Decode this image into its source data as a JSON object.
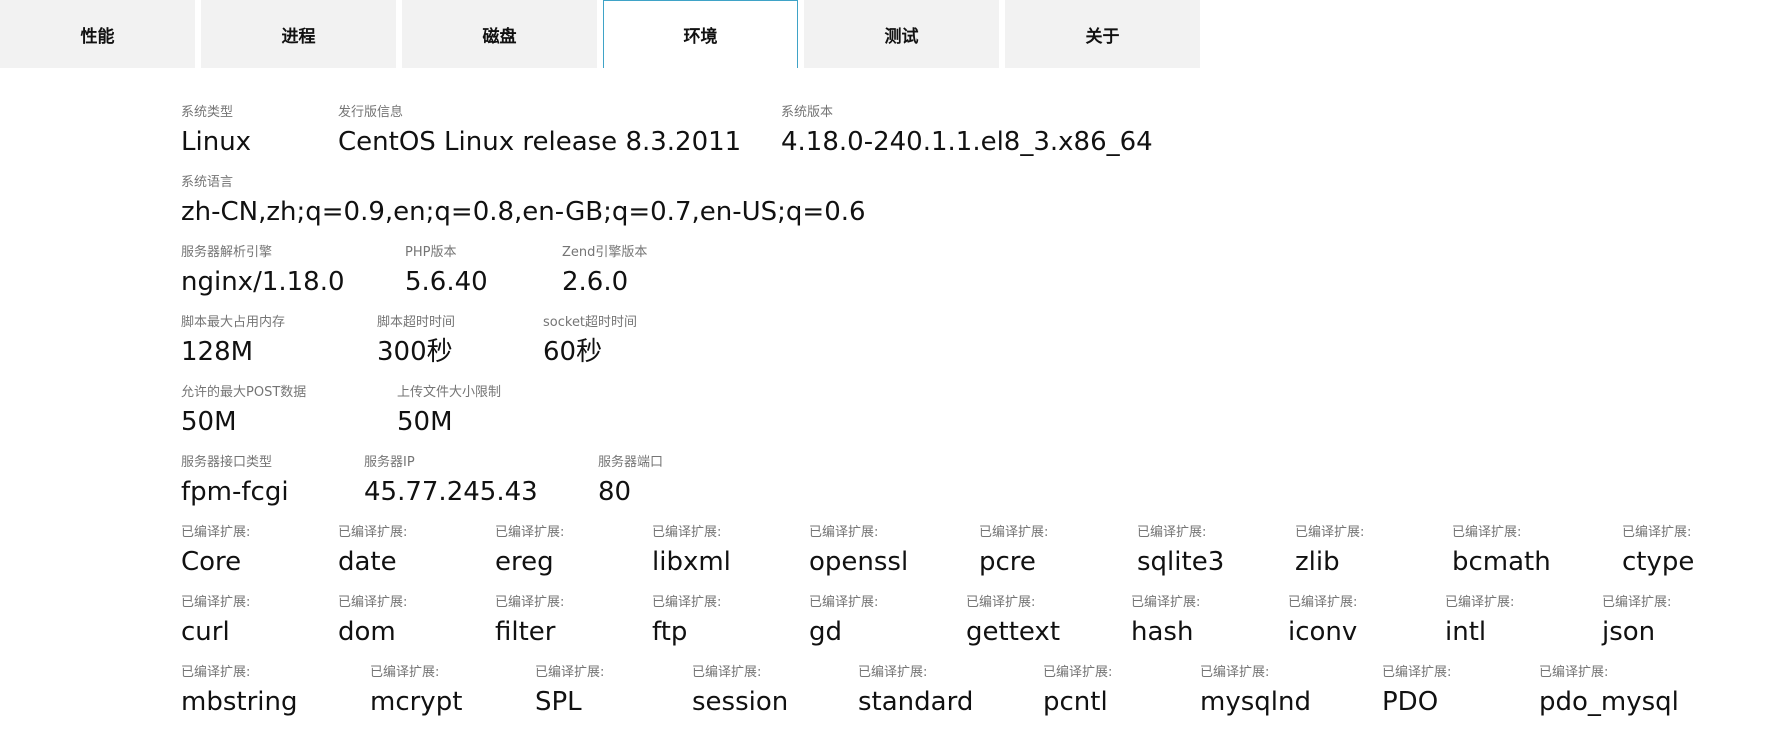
{
  "tabs": [
    {
      "label": "性能"
    },
    {
      "label": "进程"
    },
    {
      "label": "磁盘"
    },
    {
      "label": "环境"
    },
    {
      "label": "测试"
    },
    {
      "label": "关于"
    }
  ],
  "active_tab": "环境",
  "rows": [
    {
      "items": [
        {
          "label": "系统类型",
          "value": "Linux"
        },
        {
          "label": "发行版信息",
          "value": "CentOS Linux release 8.3.2011"
        },
        {
          "label": "系统版本",
          "value": "4.18.0-240.1.1.el8_3.x86_64"
        }
      ]
    },
    {
      "items": [
        {
          "label": "系统语言",
          "value": "zh-CN,zh;q=0.9,en;q=0.8,en-GB;q=0.7,en-US;q=0.6"
        }
      ]
    },
    {
      "items": [
        {
          "label": "服务器解析引擎",
          "value": "nginx/1.18.0"
        },
        {
          "label": "PHP版本",
          "value": "5.6.40"
        },
        {
          "label": "Zend引擎版本",
          "value": "2.6.0"
        }
      ]
    },
    {
      "items": [
        {
          "label": "脚本最大占用内存",
          "value": "128M"
        },
        {
          "label": "脚本超时时间",
          "value": "300秒"
        },
        {
          "label": "socket超时时间",
          "value": "60秒"
        }
      ]
    },
    {
      "items": [
        {
          "label": "允许的最大POST数据",
          "value": "50M"
        },
        {
          "label": "上传文件大小限制",
          "value": "50M"
        }
      ]
    },
    {
      "items": [
        {
          "label": "服务器接口类型",
          "value": "fpm-fcgi"
        },
        {
          "label": "服务器IP",
          "value": "45.77.245.43"
        },
        {
          "label": "服务器端口",
          "value": "80"
        }
      ]
    },
    {
      "items": [
        {
          "label": "已编译扩展:",
          "value": "Core"
        },
        {
          "label": "已编译扩展:",
          "value": "date"
        },
        {
          "label": "已编译扩展:",
          "value": "ereg"
        },
        {
          "label": "已编译扩展:",
          "value": "libxml"
        },
        {
          "label": "已编译扩展:",
          "value": "openssl"
        },
        {
          "label": "已编译扩展:",
          "value": "pcre"
        },
        {
          "label": "已编译扩展:",
          "value": "sqlite3"
        },
        {
          "label": "已编译扩展:",
          "value": "zlib"
        },
        {
          "label": "已编译扩展:",
          "value": "bcmath"
        },
        {
          "label": "已编译扩展:",
          "value": "ctype"
        }
      ]
    },
    {
      "items": [
        {
          "label": "已编译扩展:",
          "value": "curl"
        },
        {
          "label": "已编译扩展:",
          "value": "dom"
        },
        {
          "label": "已编译扩展:",
          "value": "filter"
        },
        {
          "label": "已编译扩展:",
          "value": "ftp"
        },
        {
          "label": "已编译扩展:",
          "value": "gd"
        },
        {
          "label": "已编译扩展:",
          "value": "gettext"
        },
        {
          "label": "已编译扩展:",
          "value": "hash"
        },
        {
          "label": "已编译扩展:",
          "value": "iconv"
        },
        {
          "label": "已编译扩展:",
          "value": "intl"
        },
        {
          "label": "已编译扩展:",
          "value": "json"
        }
      ]
    },
    {
      "items": [
        {
          "label": "已编译扩展:",
          "value": "mbstring"
        },
        {
          "label": "已编译扩展:",
          "value": "mcrypt"
        },
        {
          "label": "已编译扩展:",
          "value": "SPL"
        },
        {
          "label": "已编译扩展:",
          "value": "session"
        },
        {
          "label": "已编译扩展:",
          "value": "standard"
        },
        {
          "label": "已编译扩展:",
          "value": "pcntl"
        },
        {
          "label": "已编译扩展:",
          "value": "mysqlnd"
        },
        {
          "label": "已编译扩展:",
          "value": "PDO"
        },
        {
          "label": "已编译扩展:",
          "value": "pdo_mysql"
        }
      ]
    }
  ]
}
